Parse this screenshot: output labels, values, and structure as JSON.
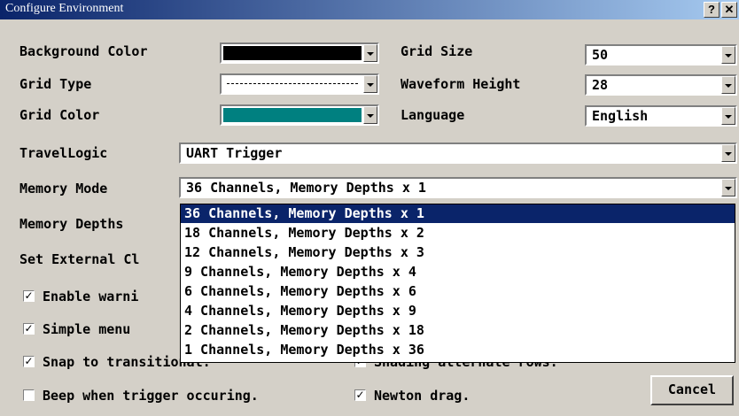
{
  "window": {
    "title": "Configure Environment",
    "help_label": "?",
    "close_label": "✕"
  },
  "fields": {
    "background_color": {
      "label": "Background Color",
      "color": "#000000"
    },
    "grid_type": {
      "label": "Grid Type"
    },
    "grid_color": {
      "label": "Grid Color",
      "color": "#008080"
    },
    "grid_size": {
      "label": "Grid Size",
      "value": "50"
    },
    "waveform_height": {
      "label": "Waveform Height",
      "value": "28"
    },
    "language": {
      "label": "Language",
      "value": "English"
    },
    "travel_logic": {
      "label": "TravelLogic",
      "value": "UART Trigger"
    },
    "memory_mode": {
      "label": "Memory Mode",
      "value": "36 Channels, Memory Depths x 1"
    },
    "memory_depths": {
      "label": "Memory Depths"
    },
    "set_external_clock": {
      "label": "Set External Cl"
    }
  },
  "memory_mode_options": [
    "36 Channels, Memory Depths x 1",
    "18 Channels, Memory Depths x 2",
    "12 Channels, Memory Depths x 3",
    "9 Channels, Memory Depths x 4",
    "6 Channels, Memory Depths x 6",
    "4 Channels, Memory Depths x 9",
    "2 Channels, Memory Depths x 18",
    "1 Channels, Memory Depths x 36"
  ],
  "checkboxes": {
    "enable_warning": {
      "label": "Enable warni",
      "checked": true
    },
    "simple_menu": {
      "label": "Simple menu",
      "checked": true
    },
    "snap_to_transitional": {
      "label": "Snap to transitional.",
      "checked": true
    },
    "beep_when_trigger": {
      "label": "Beep when trigger occuring.",
      "checked": false
    },
    "newton_drag": {
      "label": "Newton drag.",
      "checked": true
    },
    "shading_alternate_rows": {
      "label": "Shading alternate rows.",
      "checked": true
    }
  },
  "check_glyph": "✓",
  "buttons": {
    "cancel": "Cancel"
  }
}
